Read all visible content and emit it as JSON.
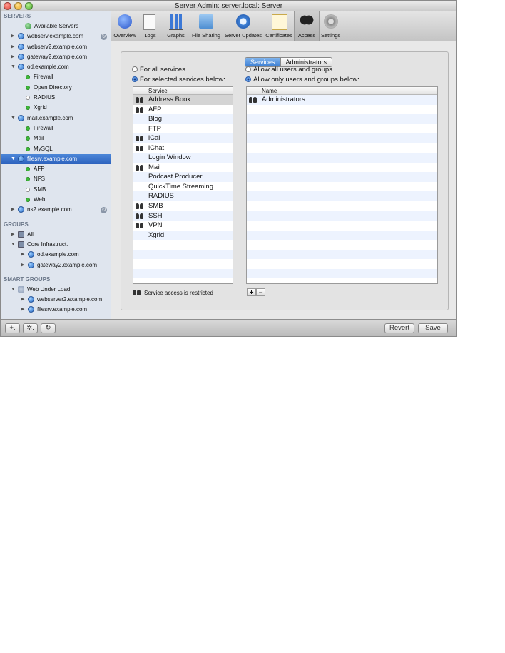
{
  "window": {
    "title": "Server Admin: server.local: Server"
  },
  "sidebar": {
    "servers_header": "SERVERS",
    "servers": [
      {
        "label": "Available Servers",
        "icon": "globe-icon",
        "indent": 1
      },
      {
        "label": "webserv.example.com",
        "icon": "server-icon",
        "tri": "▶",
        "badge": true
      },
      {
        "label": "webserv2.example.com",
        "icon": "server-icon",
        "tri": "▶"
      },
      {
        "label": "gateway2.example.com",
        "icon": "server-icon",
        "tri": "▶"
      },
      {
        "label": "od.example.com",
        "icon": "server-icon",
        "tri": "▼"
      },
      {
        "label": "Firewall",
        "status": "on",
        "child": true
      },
      {
        "label": "Open Directory",
        "status": "on",
        "child": true
      },
      {
        "label": "RADIUS",
        "status": "off",
        "child": true
      },
      {
        "label": "Xgrid",
        "status": "on",
        "child": true
      },
      {
        "label": "mail.example.com",
        "icon": "server-icon",
        "tri": "▼"
      },
      {
        "label": "Firewall",
        "status": "on",
        "child": true
      },
      {
        "label": "Mail",
        "status": "on",
        "child": true
      },
      {
        "label": "MySQL",
        "status": "on",
        "child": true
      },
      {
        "label": "filesrv.example.com",
        "icon": "server-icon",
        "tri": "▼",
        "selected": true
      },
      {
        "label": "AFP",
        "status": "on",
        "child": true
      },
      {
        "label": "NFS",
        "status": "on",
        "child": true
      },
      {
        "label": "SMB",
        "status": "off",
        "child": true
      },
      {
        "label": "Web",
        "status": "on",
        "child": true
      },
      {
        "label": "ns2.example.com",
        "icon": "server-icon",
        "tri": "▶",
        "badge": true
      }
    ],
    "groups_header": "GROUPS",
    "groups": [
      {
        "label": "All",
        "icon": "group-icon",
        "tri": "▶"
      },
      {
        "label": "Core Infrastruct.",
        "icon": "group-icon",
        "tri": "▼"
      },
      {
        "label": "od.example.com",
        "icon": "server-icon",
        "tri": "▶",
        "child": true
      },
      {
        "label": "gateway2.example.com",
        "icon": "server-icon",
        "tri": "▶",
        "child": true
      }
    ],
    "smart_groups_header": "SMART GROUPS",
    "smart_groups": [
      {
        "label": "Web Under Load",
        "icon": "smart-group-icon",
        "tri": "▼"
      },
      {
        "label": "webserver2.example.com",
        "icon": "server-icon",
        "tri": "▶",
        "child": true
      },
      {
        "label": "filesrv.example.com",
        "icon": "server-icon",
        "tri": "▶",
        "child": true
      }
    ]
  },
  "toolbar": {
    "items": [
      {
        "label": "Overview",
        "icon": "info-icon"
      },
      {
        "label": "Logs",
        "icon": "document-icon"
      },
      {
        "label": "Graphs",
        "icon": "bar-graph-icon"
      },
      {
        "label": "File Sharing",
        "icon": "shared-folder-icon"
      },
      {
        "label": "Server Updates",
        "icon": "software-update-icon"
      },
      {
        "label": "Certificates",
        "icon": "certificate-icon"
      },
      {
        "label": "Access",
        "icon": "users-icon",
        "active": true
      },
      {
        "label": "Settings",
        "icon": "gear-icon"
      }
    ]
  },
  "main": {
    "tabs": {
      "services": "Services",
      "administrators": "Administrators"
    },
    "left_options": {
      "all": "For all services",
      "selected": "For selected services below:"
    },
    "right_options": {
      "all": "Allow all users and groups",
      "only": "Allow only users and groups below:"
    },
    "services_table": {
      "header": "Service",
      "rows": [
        {
          "name": "Address Book",
          "restricted": true,
          "highlight": true
        },
        {
          "name": "AFP",
          "restricted": true
        },
        {
          "name": "Blog"
        },
        {
          "name": "FTP"
        },
        {
          "name": "iCal",
          "restricted": true
        },
        {
          "name": "iChat",
          "restricted": true
        },
        {
          "name": "Login Window"
        },
        {
          "name": "Mail",
          "restricted": true
        },
        {
          "name": "Podcast Producer"
        },
        {
          "name": "QuickTime Streaming"
        },
        {
          "name": "RADIUS"
        },
        {
          "name": "SMB",
          "restricted": true
        },
        {
          "name": "SSH",
          "restricted": true
        },
        {
          "name": "VPN",
          "restricted": true
        },
        {
          "name": "Xgrid"
        }
      ]
    },
    "users_table": {
      "header": "Name",
      "rows": [
        {
          "name": "Administrators",
          "icon": "group-icon"
        }
      ]
    },
    "restricted_note": "Service access is restricted",
    "add_label": "+",
    "remove_label": "−"
  },
  "bottom": {
    "add_label": "+.",
    "action_label": "✲.",
    "refresh_label": "↻",
    "revert_label": "Revert",
    "save_label": "Save"
  }
}
